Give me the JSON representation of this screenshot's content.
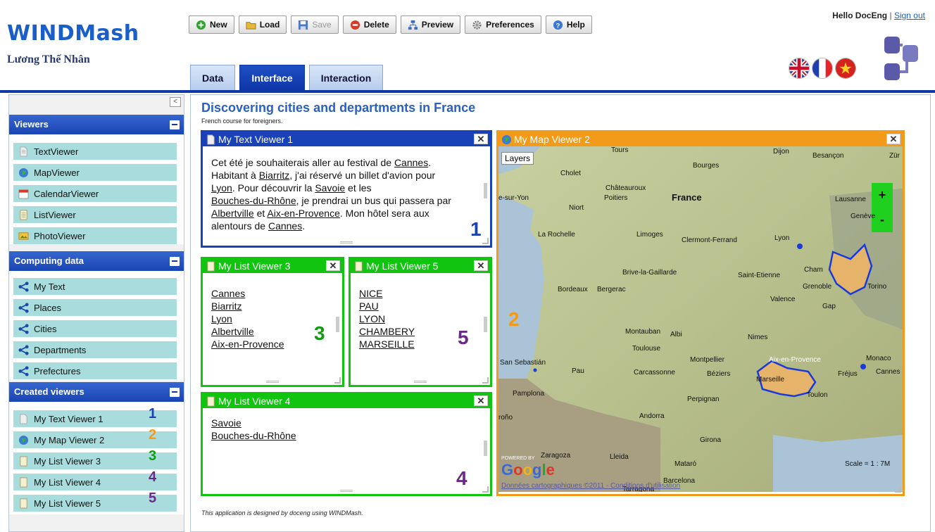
{
  "header": {
    "app_name": "WINDMash",
    "author": "Lương Thế Nhân",
    "greeting": "Hello DocEng",
    "greeting_sep": "|",
    "sign_out": "Sign out",
    "toolbar": {
      "new": "New",
      "load": "Load",
      "save": "Save",
      "delete": "Delete",
      "preview": "Preview",
      "preferences": "Preferences",
      "help": "Help"
    },
    "tabs": [
      "Data",
      "Interface",
      "Interaction"
    ],
    "active_tab": "Interface",
    "flags": [
      "uk-flag-icon",
      "france-flag-icon",
      "vietnam-flag-icon"
    ]
  },
  "sidebar": {
    "collapse_label": "<",
    "sections": {
      "viewers": {
        "title": "Viewers",
        "items": [
          "TextViewer",
          "MapViewer",
          "CalendarViewer",
          "ListViewer",
          "PhotoViewer"
        ]
      },
      "computing": {
        "title": "Computing data",
        "items": [
          "My Text",
          "Places",
          "Cities",
          "Departments",
          "Prefectures"
        ]
      },
      "created": {
        "title": "Created viewers",
        "items": [
          {
            "label": "My Text Viewer 1",
            "num": "1",
            "color": "#1942b8"
          },
          {
            "label": "My Map Viewer 2",
            "num": "2",
            "color": "#f29b1a"
          },
          {
            "label": "My List Viewer 3",
            "num": "3",
            "color": "#129a12"
          },
          {
            "label": "My List Viewer 4",
            "num": "4",
            "color": "#6a2a8a"
          },
          {
            "label": "My List Viewer 5",
            "num": "5",
            "color": "#6a2a8a"
          }
        ]
      }
    }
  },
  "main": {
    "title": "Discovering cities and departments in France",
    "subtitle": "French course for foreigners.",
    "footer": "This application is designed by doceng using WINDMash.",
    "text_viewer": {
      "title": "My Text Viewer 1",
      "num": "1",
      "line1_a": "Cet été je souhaiterais aller au festival de ",
      "cannes1": "Cannes",
      "line1_b": ".",
      "line2_a": "Habitant à ",
      "biarritz": "Biarritz",
      "line2_b": ", j'ai réservé un billet d'avion pour",
      "lyon": "Lyon",
      "line3": ". Pour découvrir la ",
      "savoie": "Savoie",
      "line3_b": " et les",
      "bdr": "Bouches-du-Rhône",
      "line4": ", je prendrai un bus qui passera par",
      "albertville": "Albertville",
      "line5_a": " et ",
      "aix": "Aix-en-Provence",
      "line5_b": ". Mon hôtel sera aux",
      "line6": "alentours de ",
      "cannes2": "Cannes",
      "line6_b": "."
    },
    "list3": {
      "title": "My List Viewer 3",
      "num": "3",
      "items": [
        "Cannes",
        "Biarritz",
        "Lyon",
        "Albertville",
        "Aix-en-Provence"
      ]
    },
    "list5": {
      "title": "My List Viewer 5",
      "num": "5",
      "items": [
        "NICE",
        "PAU",
        "LYON",
        "CHAMBERY",
        "MARSEILLE"
      ]
    },
    "list4": {
      "title": "My List Viewer 4",
      "num": "4",
      "items": [
        "Savoie",
        "Bouches-du-Rhône"
      ]
    },
    "map_viewer": {
      "title": "My Map Viewer 2",
      "num": "2",
      "layers": "Layers",
      "zoom_in": "+",
      "zoom_out": "-",
      "scale": "Scale = 1 : 7M",
      "powered_by": "POWERED BY",
      "google": "Google",
      "credits": "Données cartographiques ©2011 - Conditions d'utilisation",
      "labels": {
        "tours": "Tours",
        "dijon": "Dijon",
        "besancon": "Besançon",
        "zur": "Zür",
        "cholet": "Cholet",
        "bourges": "Bourges",
        "chateauroux": "Châteauroux",
        "sur_yon": "e-sur-Yon",
        "poitiers": "Poitiers",
        "france": "France",
        "niort": "Niort",
        "lausanne": "Lausanne",
        "geneve": "Genève",
        "la_rochelle": "La Rochelle",
        "limoges": "Limoges",
        "clermont": "Clermont-Ferrand",
        "lyon": "Lyon",
        "brive": "Brive-la-Gaillarde",
        "saint_etienne": "Saint-Etienne",
        "chambery": "Cham",
        "bordeaux": "Bordeaux",
        "begles": "Bergerac",
        "grenoble": "Grenoble",
        "torino": "Torino",
        "valence": "Valence",
        "gap": "Gap",
        "montauban": "Montauban",
        "albi": "Albi",
        "nimes": "Nimes",
        "toulouse": "Toulouse",
        "montpellier": "Montpellier",
        "aix": "Aix-en-Provence",
        "monaco": "Monaco",
        "san_sebastian": "San Sebastián",
        "pau": "Pau",
        "carcassonne": "Carcassonne",
        "beziers": "Béziers",
        "marseille": "Marseille",
        "frejus": "Fréjus",
        "cannes": "Cannes",
        "toulon": "Toulon",
        "pamplona": "Pamplona",
        "perpignan": "Perpignan",
        "andorra": "Andorra",
        "grono": "roño",
        "girona": "Girona",
        "zaragoza": "Zaragoza",
        "lleida": "Lleida",
        "mataro": "Mataró",
        "barcelona": "Barcelona",
        "tarragona": "Tarragona"
      }
    }
  }
}
